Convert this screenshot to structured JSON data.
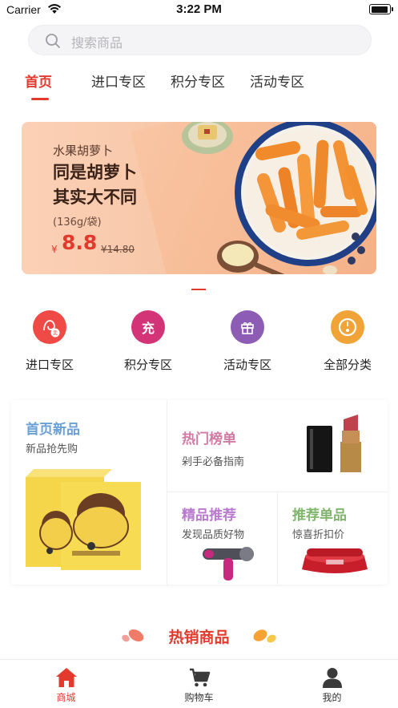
{
  "status_bar": {
    "carrier": "Carrier",
    "time": "3:22 PM"
  },
  "search": {
    "placeholder": "搜索商品"
  },
  "tabs": [
    {
      "label": "首页",
      "active": true
    },
    {
      "label": "进口专区",
      "active": false
    },
    {
      "label": "积分专区",
      "active": false
    },
    {
      "label": "活动专区",
      "active": false
    }
  ],
  "banner": {
    "subtitle": "水果胡萝卜",
    "headline_1": "同是胡萝卜",
    "headline_2": "其实大不同",
    "spec": "(136g/袋)",
    "currency": "¥",
    "price": "8.8",
    "original_price": "¥14.80"
  },
  "quick_entries": [
    {
      "label": "进口专区",
      "icon": "import-icon",
      "color": "#ef4a45",
      "glyph": ""
    },
    {
      "label": "积分专区",
      "icon": "recharge-icon",
      "color": "#d23477",
      "glyph": "充"
    },
    {
      "label": "活动专区",
      "icon": "gift-icon",
      "color": "#8d5cb4",
      "glyph": ""
    },
    {
      "label": "全部分类",
      "icon": "category-icon",
      "color": "#f0a437",
      "glyph": ""
    }
  ],
  "modules": {
    "new": {
      "title": "首页新品",
      "subtitle": "新品抢先购",
      "color": "#6aa0d6"
    },
    "hot": {
      "title": "热门榜单",
      "subtitle": "剁手必备指南",
      "color": "#d17aa5"
    },
    "quality": {
      "title": "精品推荐",
      "subtitle": "发现品质好物",
      "color": "#b77acd"
    },
    "single": {
      "title": "推荐单品",
      "subtitle": "惊喜折扣价",
      "color": "#7fb66b"
    }
  },
  "hot_section": {
    "title": "热销商品"
  },
  "tabbar": [
    {
      "label": "商城",
      "icon": "home-icon",
      "active": true
    },
    {
      "label": "购物车",
      "icon": "cart-icon",
      "active": false
    },
    {
      "label": "我的",
      "icon": "user-icon",
      "active": false
    }
  ],
  "colors": {
    "accent": "#e33a2e"
  }
}
